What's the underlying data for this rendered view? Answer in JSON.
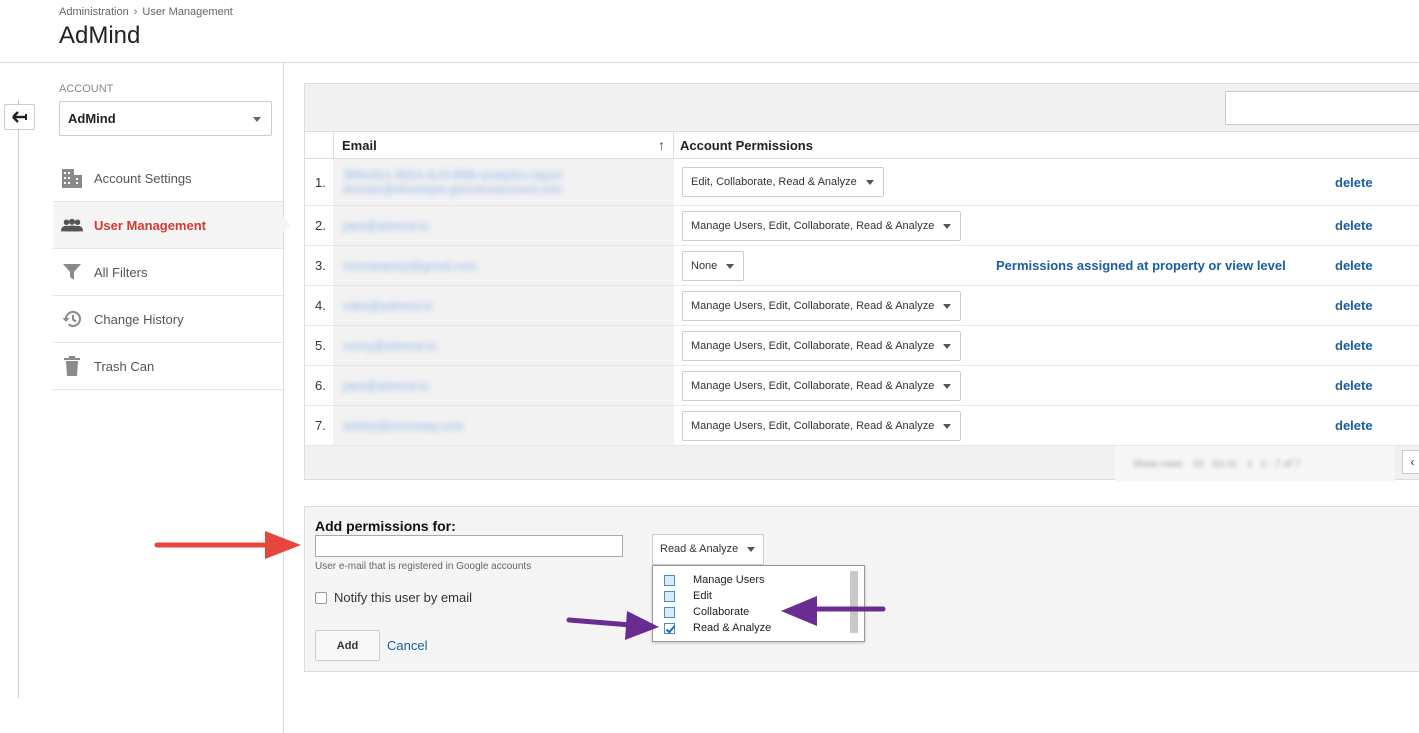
{
  "header": {
    "breadcrumb": [
      "Administration",
      "User Management"
    ],
    "breadcrumb_sep": "›",
    "title": "AdMind"
  },
  "sidebar": {
    "account_label": "ACCOUNT",
    "account_value": "AdMind",
    "items": [
      {
        "label": "Account Settings",
        "icon": "building-icon",
        "active": false
      },
      {
        "label": "User Management",
        "icon": "users-icon",
        "active": true
      },
      {
        "label": "All Filters",
        "icon": "filter-icon",
        "active": false
      },
      {
        "label": "Change History",
        "icon": "history-icon",
        "active": false
      },
      {
        "label": "Trash Can",
        "icon": "trash-icon",
        "active": false
      }
    ]
  },
  "users_table": {
    "columns": {
      "email": "Email",
      "permissions": "Account Permissions"
    },
    "sort_icon": "↑",
    "delete_label": "delete",
    "rows": [
      {
        "num": "1.",
        "email_lines": [
          "3f4bc0c1-9d14-4c1f-8f9b-analytics-report",
          "domain@developer.gserviceaccount.com"
        ],
        "permission": "Edit, Collaborate, Read & Analyze",
        "note": ""
      },
      {
        "num": "2.",
        "email_lines": [
          "jake@admind.io"
        ],
        "permission": "Manage Users, Edit, Collaborate, Read & Analyze",
        "note": ""
      },
      {
        "num": "3.",
        "email_lines": [
          "michaelpaxy@gmail.com"
        ],
        "permission": "None",
        "note": "Permissions assigned at property or view level"
      },
      {
        "num": "4.",
        "email_lines": [
          "mike@admind.io"
        ],
        "permission": "Manage Users, Edit, Collaborate, Read & Analyze",
        "note": ""
      },
      {
        "num": "5.",
        "email_lines": [
          "corey@admind.io"
        ],
        "permission": "Manage Users, Edit, Collaborate, Read & Analyze",
        "note": ""
      },
      {
        "num": "6.",
        "email_lines": [
          "jake@admind.io"
        ],
        "permission": "Manage Users, Edit, Collaborate, Read & Analyze",
        "note": ""
      },
      {
        "num": "7.",
        "email_lines": [
          "ashley@someday.com"
        ],
        "permission": "Manage Users, Edit, Collaborate, Read & Analyze",
        "note": ""
      }
    ],
    "pager": {
      "rows_label": "Show rows:",
      "rows_value": "10",
      "goto_label": "Go to:",
      "goto_value": "1",
      "range": "1 - 7 of 7"
    },
    "prev_icon": "‹"
  },
  "add_permissions": {
    "title": "Add permissions for:",
    "email_value": "",
    "helper": "User e-mail that is registered in Google accounts",
    "notify_label": "Notify this user by email",
    "notify_checked": false,
    "role_selected": "Read & Analyze",
    "role_options": [
      {
        "label": "Manage Users",
        "checked": false
      },
      {
        "label": "Edit",
        "checked": false
      },
      {
        "label": "Collaborate",
        "checked": false
      },
      {
        "label": "Read & Analyze",
        "checked": true
      }
    ],
    "add_label": "Add",
    "cancel_label": "Cancel"
  },
  "colors": {
    "active_nav": "#d33a2f",
    "link": "#1a5ea1",
    "red_arrow": "#e8453c",
    "purple_arrow": "#6a2c91"
  }
}
